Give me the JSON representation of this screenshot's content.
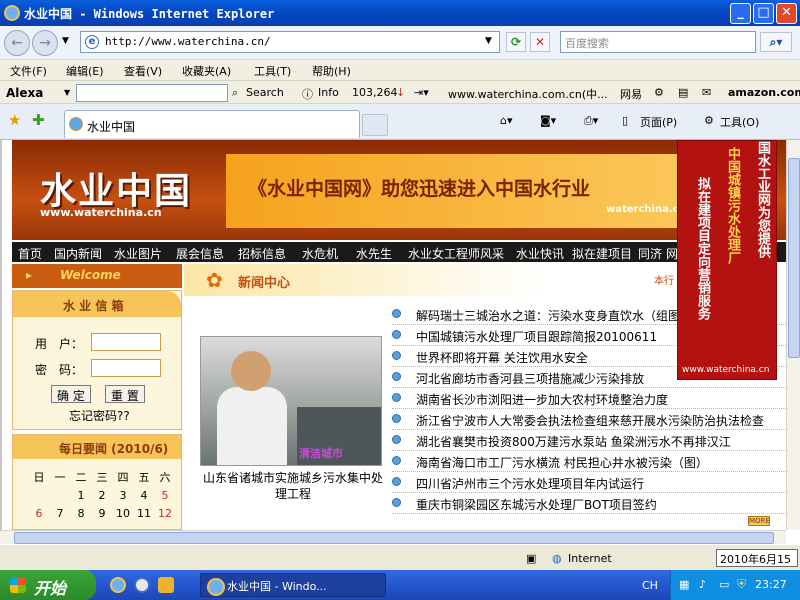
{
  "window": {
    "title": "水业中国 - Windows Internet Explorer",
    "min": "_",
    "max": "□",
    "close": "✕"
  },
  "address_bar": {
    "url": "http://www.waterchina.cn/",
    "search_placeholder": "百度搜索"
  },
  "menu": [
    "文件(F)",
    "编辑(E)",
    "查看(V)",
    "收藏夹(A)",
    "工具(T)",
    "帮助(H)"
  ],
  "alexa_bar": {
    "brand": "Alexa",
    "search": "Search",
    "info": "Info",
    "rank": "103,264",
    "site": "www.waterchina.com.cn(中...",
    "netease": "网易",
    "amazon": "amazon.com"
  },
  "tab": {
    "title": "水业中国",
    "page_menu": "页面(P)",
    "tools_menu": "工具(O)"
  },
  "site": {
    "logo": "水业中国",
    "logo_url": "www.waterchina.cn",
    "slogan": "《水业中国网》助您迅速进入中国水行业",
    "slogan_sub": "waterchina.cn",
    "nav": [
      "首页",
      "国内新闻",
      "水业图片",
      "展会信息",
      "招标信息",
      "水危机",
      "水先生",
      "水业女工程师风采",
      "水业快讯",
      "拟在建项目",
      "同济",
      "网"
    ],
    "welcome": "Welcome",
    "mailbox_title": "水 业 信 箱",
    "user_label": "用　户：",
    "pass_label": "密　码：",
    "ok_btn": "确 定",
    "reset_btn": "重 置",
    "forgot": "忘记密码??",
    "calendar_title": "每日要闻 (2010/6)",
    "weekdays": [
      "日",
      "一",
      "二",
      "三",
      "四",
      "五",
      "六"
    ],
    "cal_row1": [
      "",
      "",
      "1",
      "2",
      "3",
      "4",
      "5"
    ],
    "cal_row2": [
      "6",
      "7",
      "8",
      "9",
      "10",
      "11",
      "12"
    ],
    "news_title": "新闻中心",
    "news_more_label": "本行",
    "photo_watermark": "清洁城市",
    "photo_caption": "山东省诸城市实施城乡污水集中处理工程",
    "news": [
      "解码瑞士三城治水之道：污染水变身直饮水（组图）",
      "中国城镇污水处理厂项目跟踪简报20100611",
      "世界杯即将开幕 关注饮用水安全",
      "河北省廊坊市香河县三项措施减少污染排放",
      "湖南省长沙市浏阳进一步加大农村环境整治力度",
      "浙江省宁波市人大常委会执法检查组来慈开展水污染防治执法检查",
      "湖北省襄樊市投资800万建污水泵站 鱼梁洲污水不再排汉江",
      "海南省海口市工厂污水横流 村民担心井水被污染（图）",
      "四川省泸州市三个污水处理项目年内试运行",
      "重庆市铜梁园区东城污水处理厂BOT项目签约"
    ],
    "more": "MORE",
    "ad_col1": "国水工业网为您提供",
    "ad_col2": "中国城镇污水处理厂",
    "ad_col3": "拟在建项目定向营销服务",
    "ad_url": "www.waterchina.cn"
  },
  "status": {
    "zone": "Internet",
    "date": "2010年6月15日"
  },
  "taskbar": {
    "start": "开始",
    "task": "水业中国 - Windo...",
    "lang": "CH",
    "clock": "23:27"
  }
}
